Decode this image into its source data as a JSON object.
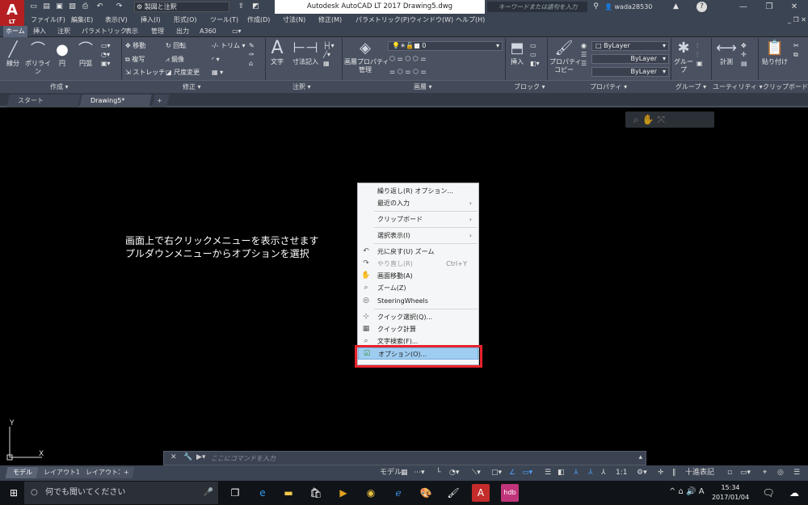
{
  "title_bar": {
    "app_logo": "A",
    "app_logo_sub": "LT",
    "workspace": "製図と注釈",
    "app_title": "Autodesk AutoCAD LT 2017    Drawing5.dwg",
    "search_placeholder": "キーワードまたは語句を入力",
    "user": "wada28530",
    "help": "?"
  },
  "menu": [
    "ファイル(F)",
    "編集(E)",
    "表示(V)",
    "挿入(I)",
    "形式(O)",
    "ツール(T)",
    "作成(D)",
    "寸法(N)",
    "修正(M)",
    "パラメトリック(P)",
    "ウィンドウ(W)",
    "ヘルプ(H)"
  ],
  "ribbon_tabs": [
    "ホーム",
    "挿入",
    "注釈",
    "パラメトリック",
    "表示",
    "管理",
    "出力",
    "A360"
  ],
  "ribbon": {
    "draw_tools": [
      "線分",
      "ポリライン",
      "円",
      "円弧"
    ],
    "modify_tools": [
      "移動",
      "回転",
      "トリム",
      "複写",
      "鏡像",
      "ストレッチ",
      "尺度変更"
    ],
    "annotation_tools": [
      "文字",
      "寸法記入"
    ],
    "layer_tool": "画層プロパティ\n管理",
    "layer_value": "0",
    "insert_tool": "挿入",
    "props_tool": "プロパティ\nコピー",
    "bylayer": [
      "ByLayer",
      "ByLayer",
      "ByLayer"
    ],
    "group_tool": "グループ",
    "measure_tool": "計測",
    "paste_tool": "貼り付け",
    "panels": [
      "作成",
      "修正",
      "注釈",
      "画層",
      "ブロック",
      "プロパティ",
      "グループ",
      "ユーティリティ",
      "クリップボード"
    ]
  },
  "doc_tabs": [
    "スタート",
    "Drawing5*"
  ],
  "viewport_note": "画面上で右クリックメニューを表示させます\nプルダウンメニューからオプションを選択",
  "context_menu": [
    {
      "label": "繰り返し(R) オプション...",
      "icon": "",
      "arrow": "",
      "shortcut": ""
    },
    {
      "label": "最近の入力",
      "icon": "",
      "arrow": "›",
      "shortcut": ""
    },
    {
      "label": "クリップボード",
      "icon": "",
      "arrow": "›",
      "shortcut": ""
    },
    {
      "label": "選択表示(I)",
      "icon": "",
      "arrow": "›",
      "shortcut": ""
    },
    {
      "label": "元に戻す(U) ズーム",
      "icon": "↶",
      "arrow": "",
      "shortcut": ""
    },
    {
      "label": "やり直し(R)",
      "icon": "↷",
      "arrow": "",
      "shortcut": "Ctrl+Y"
    },
    {
      "label": "画面移動(A)",
      "icon": "✋",
      "arrow": "",
      "shortcut": ""
    },
    {
      "label": "ズーム(Z)",
      "icon": "⌕",
      "arrow": "",
      "shortcut": ""
    },
    {
      "label": "SteeringWheels",
      "icon": "◎",
      "arrow": "",
      "shortcut": ""
    },
    {
      "label": "クイック選択(Q)...",
      "icon": "⊹",
      "arrow": "",
      "shortcut": ""
    },
    {
      "label": "クイック計算",
      "icon": "▦",
      "arrow": "",
      "shortcut": ""
    },
    {
      "label": "文字検索(F)...",
      "icon": "⌕",
      "arrow": "",
      "shortcut": ""
    },
    {
      "label": "オプション(O)...",
      "icon": "☑",
      "arrow": "",
      "shortcut": ""
    }
  ],
  "ucs": {
    "x": "X",
    "y": "Y"
  },
  "command_line": {
    "placeholder": "ここにコマンドを入力"
  },
  "layout_tabs": [
    "モデル",
    "レイアウト1",
    "レイアウト2",
    "+"
  ],
  "status_bar": {
    "model": "モデル",
    "scale": "1:1",
    "annotation": "十進表記"
  },
  "taskbar": {
    "search_placeholder": "何でも聞いてください",
    "time": "15:34",
    "date": "2017/01/04",
    "ime": "A"
  }
}
